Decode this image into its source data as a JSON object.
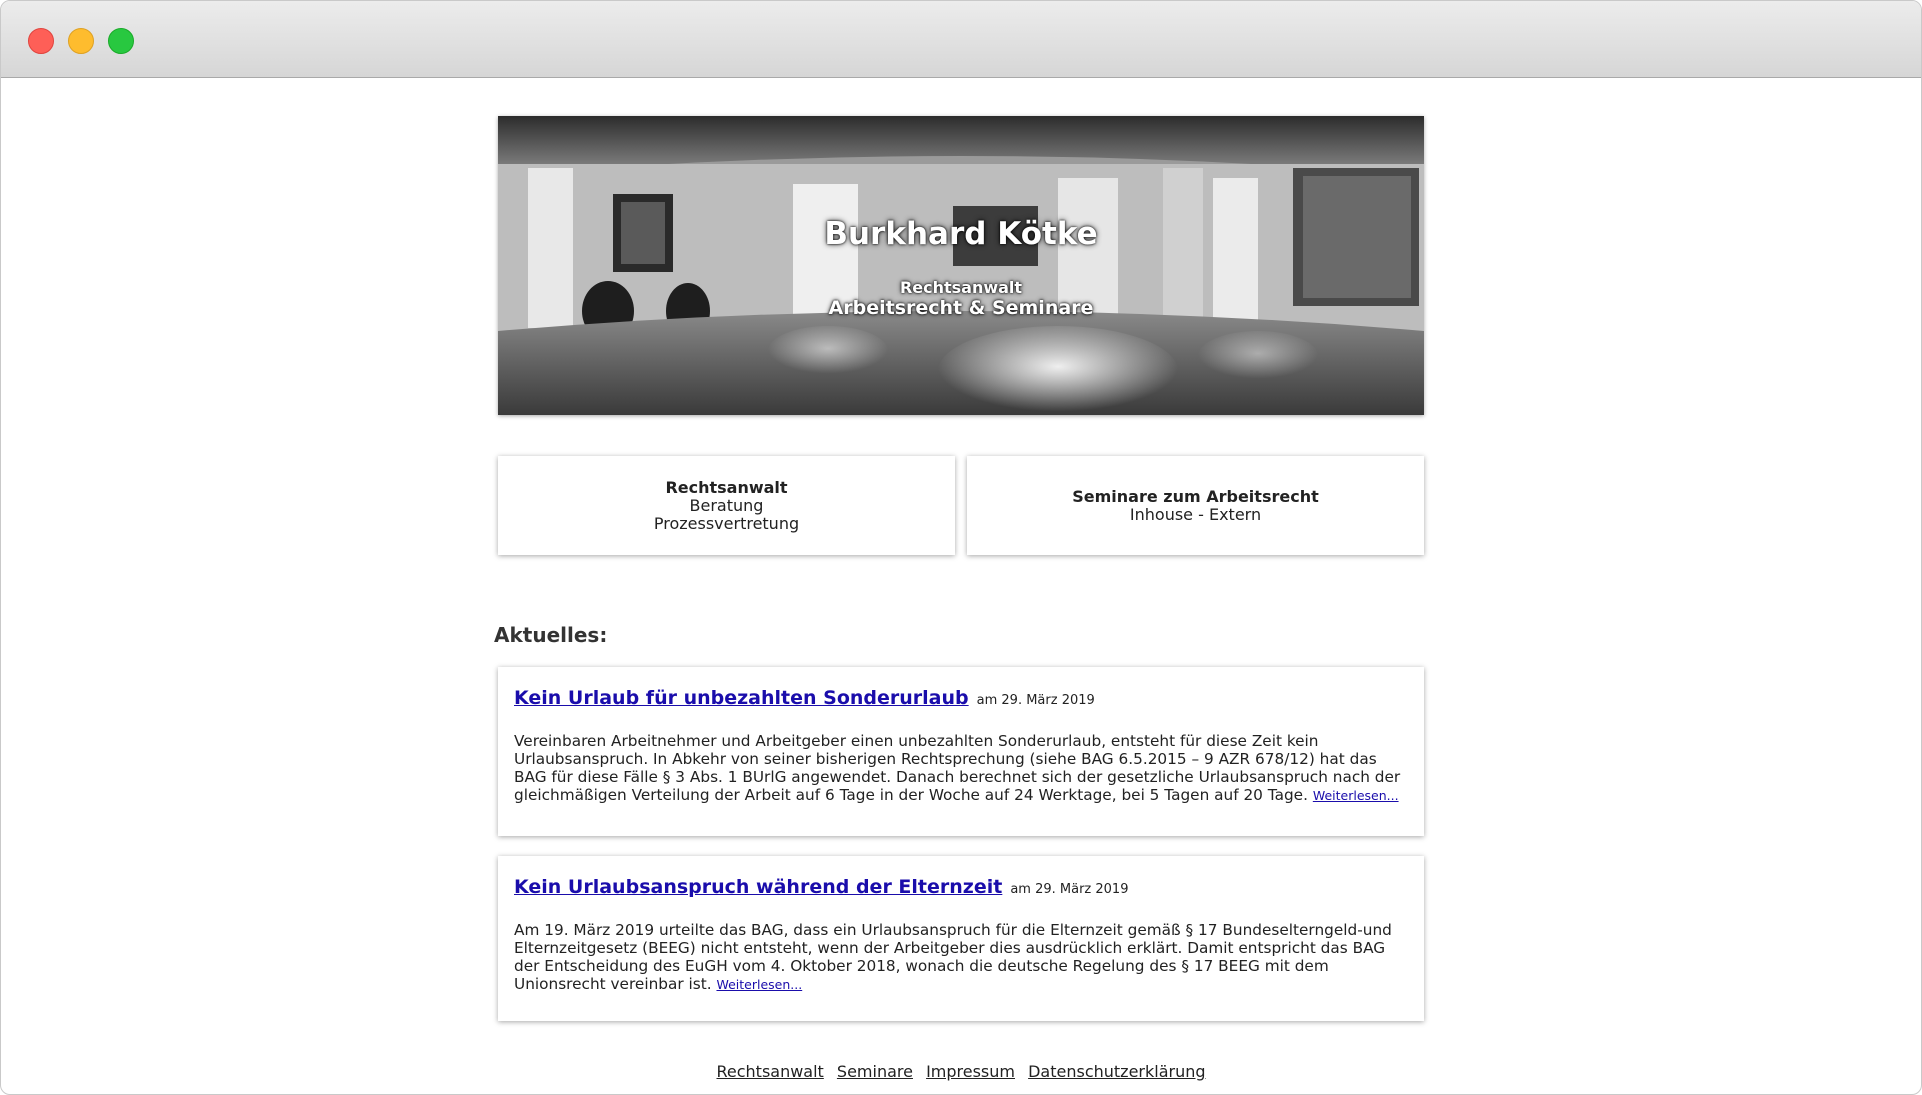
{
  "hero": {
    "title": "Burkhard Kötke",
    "subtitle": "Rechtsanwalt",
    "tagline": "Arbeitsrecht & Seminare"
  },
  "cards": [
    {
      "title": "Rechtsanwalt",
      "lines": [
        "Beratung",
        "Prozessvertretung"
      ]
    },
    {
      "title": "Seminare zum Arbeitsrecht",
      "lines": [
        "Inhouse - Extern"
      ]
    }
  ],
  "news": {
    "heading": "Aktuelles:",
    "articles": [
      {
        "title": "Kein Urlaub für unbezahlten Sonderurlaub",
        "date": "am 29. März 2019",
        "body": "Vereinbaren Arbeitnehmer und Arbeitgeber einen unbezahlten Sonderurlaub, entsteht für diese Zeit kein Urlaubsanspruch. In Abkehr von seiner bisherigen Rechtsprechung (siehe BAG 6.5.2015 – 9 AZR 678/12) hat das BAG für diese Fälle § 3 Abs. 1 BUrlG angewendet. Danach berechnet sich der gesetzliche Urlaubsanspruch nach der gleichmäßigen Verteilung der Arbeit auf 6 Tage in der Woche auf 24 Werktage, bei 5 Tagen auf 20 Tage.",
        "more": "Weiterlesen..."
      },
      {
        "title": "Kein Urlaubsanspruch während der Elternzeit",
        "date": "am 29. März 2019",
        "body": "Am 19. März 2019 urteilte das BAG, dass ein Urlaubsanspruch für die Elternzeit gemäß § 17 Bundeselterngeld-und Elternzeitgesetz (BEEG) nicht entsteht, wenn der Arbeitgeber dies ausdrücklich erklärt. Damit entspricht das BAG der Entscheidung des EuGH vom 4. Oktober 2018, wonach die deutsche Regelung des § 17 BEEG mit dem Unionsrecht vereinbar ist.",
        "more": "Weiterlesen..."
      }
    ]
  },
  "footer": {
    "links": [
      "Rechtsanwalt",
      "Seminare",
      "Impressum",
      "Datenschutzerklärung"
    ]
  }
}
